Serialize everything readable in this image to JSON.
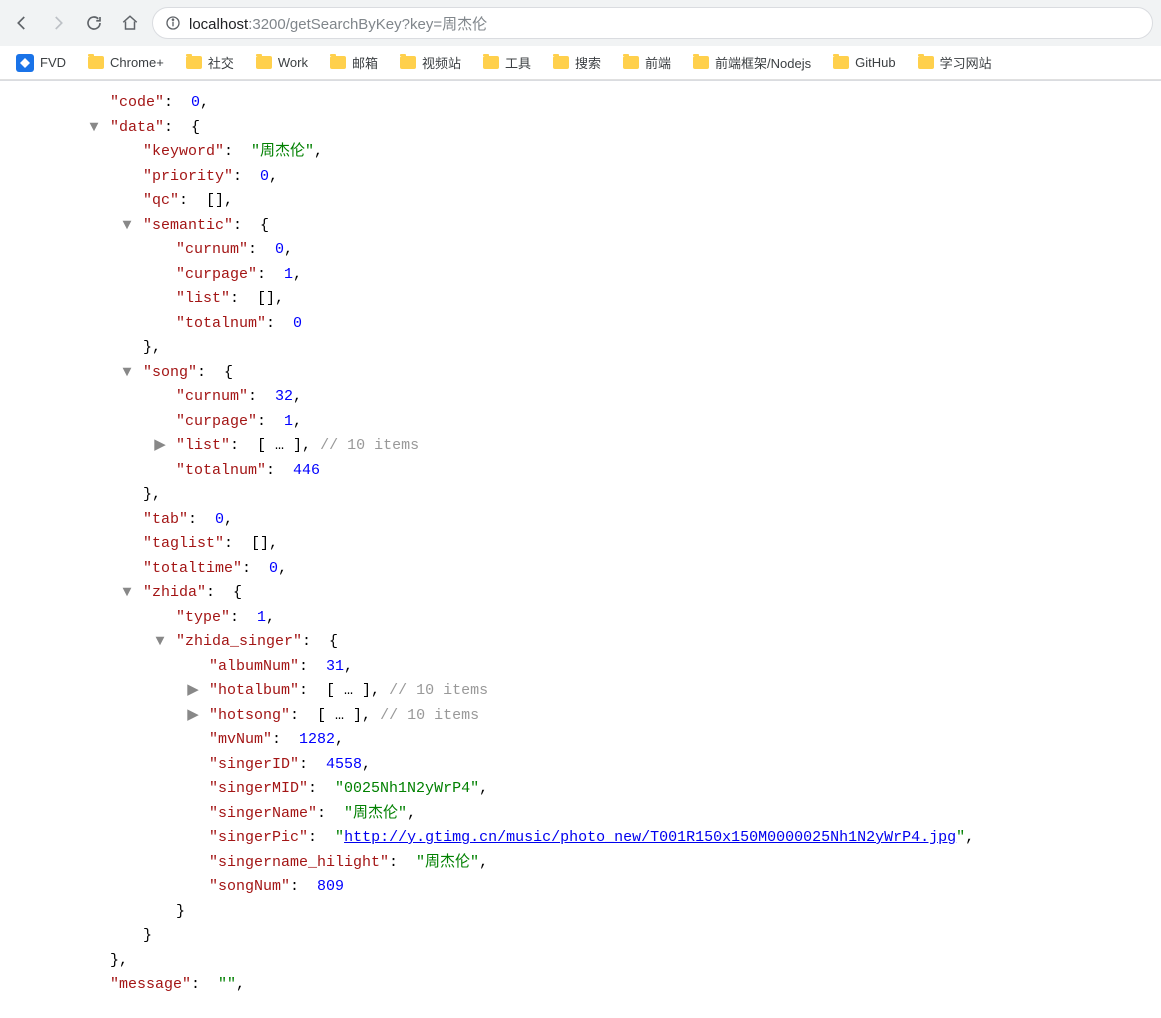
{
  "url": {
    "info_icon": "ⓘ",
    "host": "localhost",
    "port_path": ":3200/getSearchByKey?key=周杰伦"
  },
  "bookmarks": [
    {
      "icon": "fvd",
      "label": "FVD"
    },
    {
      "icon": "folder",
      "label": "Chrome+"
    },
    {
      "icon": "folder",
      "label": "社交"
    },
    {
      "icon": "folder",
      "label": "Work"
    },
    {
      "icon": "folder",
      "label": "邮箱"
    },
    {
      "icon": "folder",
      "label": "视频站"
    },
    {
      "icon": "folder",
      "label": "工具"
    },
    {
      "icon": "folder",
      "label": "搜索"
    },
    {
      "icon": "folder",
      "label": "前端"
    },
    {
      "icon": "folder",
      "label": "前端框架/Nodejs"
    },
    {
      "icon": "folder",
      "label": "GitHub"
    },
    {
      "icon": "folder",
      "label": "学习网站"
    }
  ],
  "toggles": {
    "down": "▼",
    "right": "▶"
  },
  "json": {
    "code": {
      "key": "\"code\"",
      "val": "0"
    },
    "data_key": "\"data\"",
    "keyword": {
      "key": "\"keyword\"",
      "val": "\"周杰伦\""
    },
    "priority": {
      "key": "\"priority\"",
      "val": "0"
    },
    "qc": {
      "key": "\"qc\"",
      "val": "[]"
    },
    "semantic_key": "\"semantic\"",
    "semantic": {
      "curnum": {
        "key": "\"curnum\"",
        "val": "0"
      },
      "curpage": {
        "key": "\"curpage\"",
        "val": "1"
      },
      "list": {
        "key": "\"list\"",
        "val": "[]"
      },
      "totalnum": {
        "key": "\"totalnum\"",
        "val": "0"
      }
    },
    "song_key": "\"song\"",
    "song": {
      "curnum": {
        "key": "\"curnum\"",
        "val": "32"
      },
      "curpage": {
        "key": "\"curpage\"",
        "val": "1"
      },
      "list": {
        "key": "\"list\"",
        "val": "[ … ]",
        "comment": "// 10 items"
      },
      "totalnum": {
        "key": "\"totalnum\"",
        "val": "446"
      }
    },
    "tab": {
      "key": "\"tab\"",
      "val": "0"
    },
    "taglist": {
      "key": "\"taglist\"",
      "val": "[]"
    },
    "totaltime": {
      "key": "\"totaltime\"",
      "val": "0"
    },
    "zhida_key": "\"zhida\"",
    "zhida": {
      "type": {
        "key": "\"type\"",
        "val": "1"
      },
      "singer_key": "\"zhida_singer\"",
      "singer": {
        "albumNum": {
          "key": "\"albumNum\"",
          "val": "31"
        },
        "hotalbum": {
          "key": "\"hotalbum\"",
          "val": "[ … ]",
          "comment": "// 10 items"
        },
        "hotsong": {
          "key": "\"hotsong\"",
          "val": "[ … ]",
          "comment": "// 10 items"
        },
        "mvNum": {
          "key": "\"mvNum\"",
          "val": "1282"
        },
        "singerID": {
          "key": "\"singerID\"",
          "val": "4558"
        },
        "singerMID": {
          "key": "\"singerMID\"",
          "val": "\"0025Nh1N2yWrP4\""
        },
        "singerName": {
          "key": "\"singerName\"",
          "val": "\"周杰伦\""
        },
        "singerPic": {
          "key": "\"singerPic\"",
          "val_open": "\"",
          "link": "http://y.gtimg.cn/music/photo_new/T001R150x150M0000025Nh1N2yWrP4.jpg",
          "val_close": "\""
        },
        "singername_hilight": {
          "key": "\"singername_hilight\"",
          "val": "\"周杰伦\""
        },
        "songNum": {
          "key": "\"songNum\"",
          "val": "809"
        }
      }
    },
    "message": {
      "key": "\"message\"",
      "val": "\"\""
    }
  }
}
